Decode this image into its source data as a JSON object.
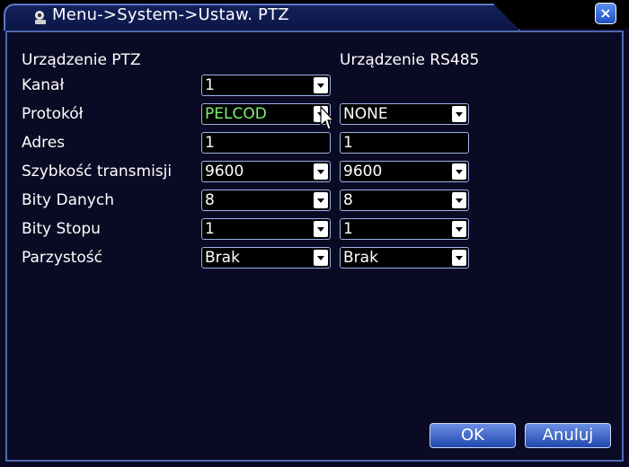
{
  "window": {
    "title": "Menu->System->Ustaw. PTZ",
    "close_label": "×"
  },
  "headers": {
    "ptz": "Urządzenie PTZ",
    "rs485": "Urządzenie RS485"
  },
  "rows": [
    {
      "label": "Kanał",
      "ptz": "1",
      "ptz_type": "dropdown",
      "rs485": null
    },
    {
      "label": "Protokół",
      "ptz": "PELCOD",
      "ptz_type": "dropdown",
      "rs485": "NONE",
      "rs485_type": "dropdown"
    },
    {
      "label": "Adres",
      "ptz": "1",
      "ptz_type": "text",
      "rs485": "1",
      "rs485_type": "text"
    },
    {
      "label": "Szybkość transmisji",
      "ptz": "9600",
      "ptz_type": "dropdown",
      "rs485": "9600",
      "rs485_type": "dropdown"
    },
    {
      "label": "Bity Danych",
      "ptz": "8",
      "ptz_type": "dropdown",
      "rs485": "8",
      "rs485_type": "dropdown"
    },
    {
      "label": "Bity Stopu",
      "ptz": "1",
      "ptz_type": "dropdown",
      "rs485": "1",
      "rs485_type": "dropdown"
    },
    {
      "label": "Parzystość",
      "ptz": "Brak",
      "ptz_type": "dropdown",
      "rs485": "Brak",
      "rs485_type": "dropdown"
    }
  ],
  "buttons": {
    "ok": "OK",
    "cancel": "Anuluj"
  },
  "colors": {
    "accent_border": "#5d77c4",
    "highlight_text": "#7df070",
    "button_top": "#6c8fe4",
    "button_bottom": "#2048b0"
  },
  "icons": [
    "camera-icon",
    "close-icon",
    "chevron-down-icon",
    "mouse-pointer-icon"
  ]
}
